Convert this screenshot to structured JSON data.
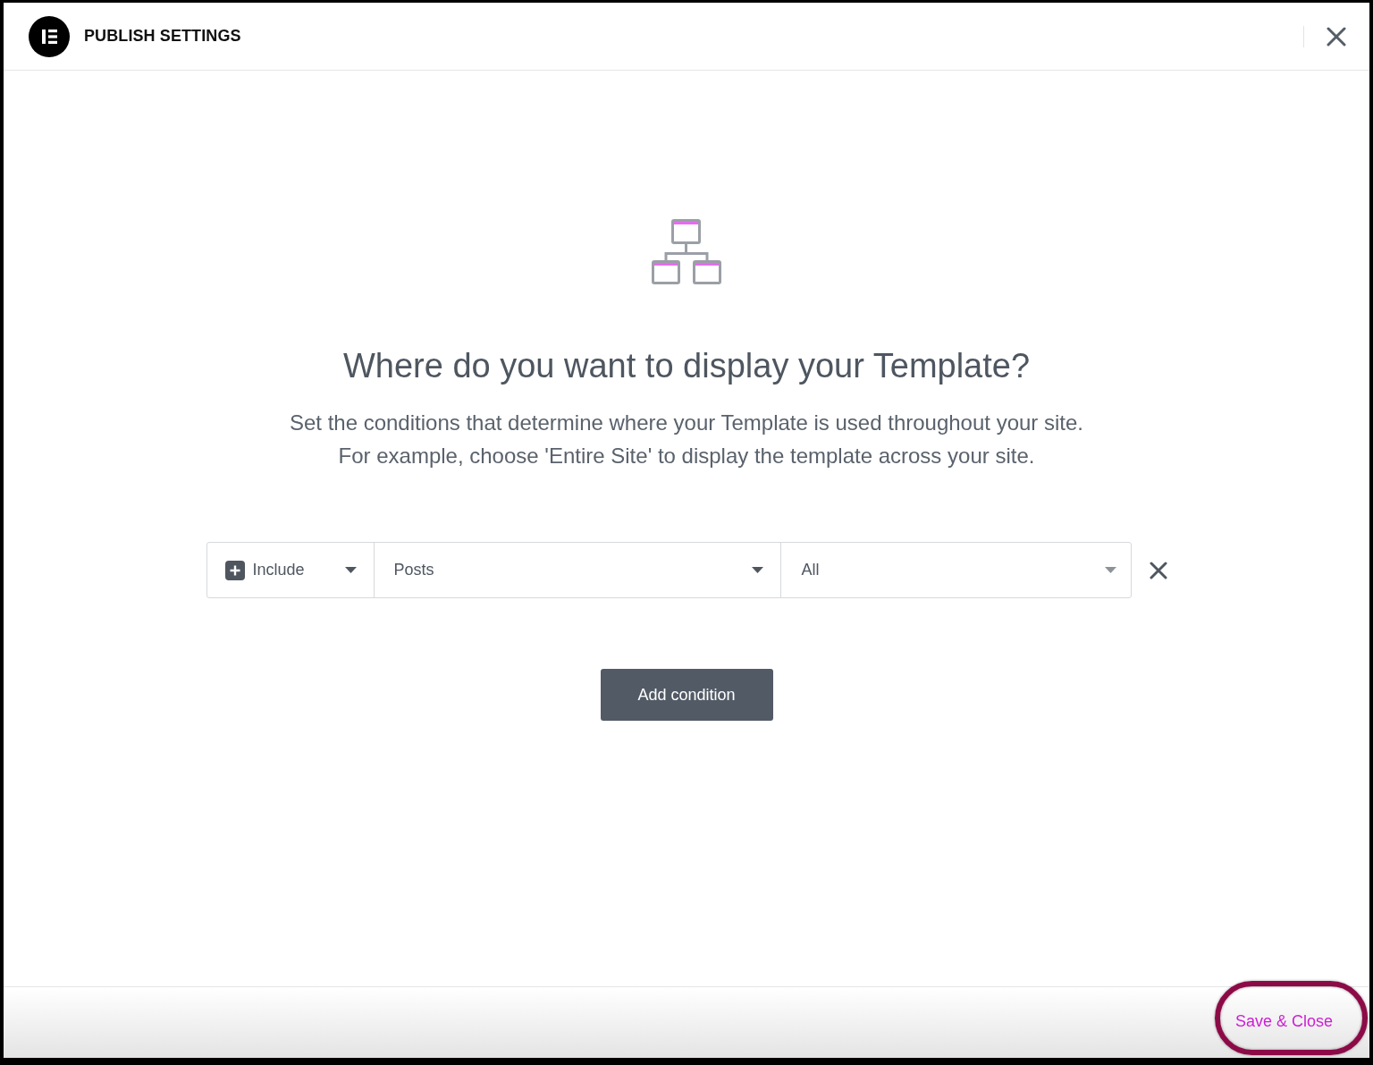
{
  "dialog": {
    "title": "PUBLISH SETTINGS"
  },
  "intro": {
    "heading": "Where do you want to display your Template?",
    "description": [
      "Set the conditions that determine where your Template is used throughout your site.",
      "For example, choose 'Entire Site' to display the template across your site."
    ]
  },
  "conditions": [
    {
      "mode": "Include",
      "rule": "Posts",
      "sub_rule": "All"
    }
  ],
  "add_condition_button": "Add condition",
  "footer": {
    "save_button": "Save & Close",
    "highlighted": true
  }
}
